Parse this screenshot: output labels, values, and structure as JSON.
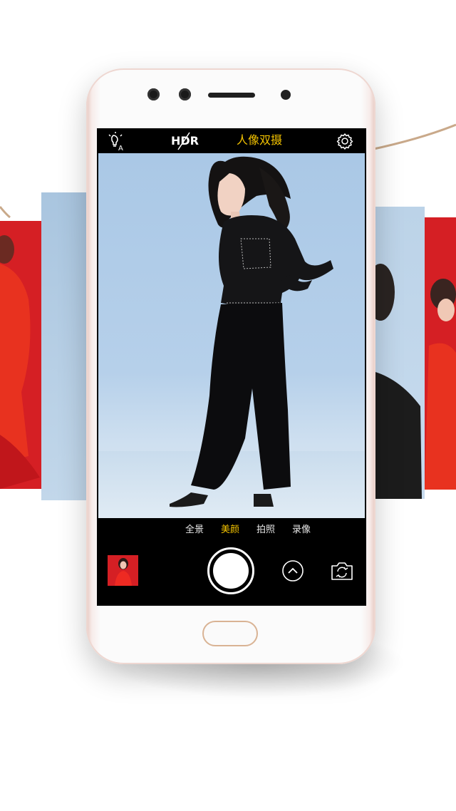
{
  "camera": {
    "top_bar": {
      "flash_icon": "flash-auto-icon",
      "hdr_label": "HDR",
      "hdr_state": "off",
      "mode_title": "人像双摄",
      "settings_icon": "gear-icon"
    },
    "modes": [
      {
        "label": "全景",
        "active": false
      },
      {
        "label": "美颜",
        "active": true
      },
      {
        "label": "拍照",
        "active": false
      },
      {
        "label": "录像",
        "active": false
      }
    ],
    "controls": {
      "thumbnail_icon": "gallery-thumbnail",
      "shutter_icon": "shutter-button",
      "more_icon": "chevron-up-icon",
      "switch_icon": "switch-camera-icon"
    }
  },
  "colors": {
    "accent": "#f2c200",
    "brand_red": "#d51f24",
    "sky": "#aac8e6",
    "phone_frame": "#e6c7bf"
  }
}
